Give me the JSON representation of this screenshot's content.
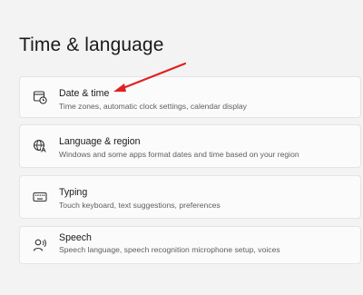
{
  "page": {
    "title": "Time & language"
  },
  "items": [
    {
      "icon": "calendar-clock-icon",
      "title": "Date & time",
      "description": "Time zones, automatic clock settings, calendar display"
    },
    {
      "icon": "globe-language-icon",
      "title": "Language & region",
      "description": "Windows and some apps format dates and time based on your region"
    },
    {
      "icon": "keyboard-icon",
      "title": "Typing",
      "description": "Touch keyboard, text suggestions, preferences"
    },
    {
      "icon": "speech-person-icon",
      "title": "Speech",
      "description": "Speech language, speech recognition microphone setup, voices"
    }
  ],
  "annotation": {
    "arrow_color": "#e02020"
  }
}
